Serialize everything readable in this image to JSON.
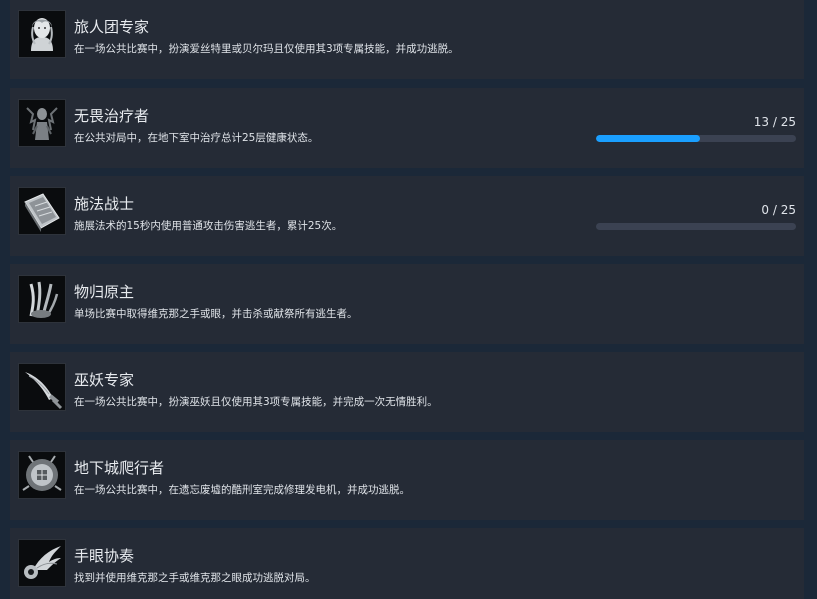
{
  "colors": {
    "background": "#1b2838",
    "card": "#252b36",
    "progress_fill": "#1a9fff",
    "progress_track": "#3b4252"
  },
  "achievements": [
    {
      "icon": "portrait-icon",
      "title": "旅人团专家",
      "description": "在一场公共比赛中，扮演爱丝特里或贝尔玛且仅使用其3项专属技能，并成功逃脱。"
    },
    {
      "icon": "healer-figure-icon",
      "title": "无畏治疗者",
      "description": "在公共对局中，在地下室中治疗总计25层健康状态。",
      "progress_text": "13 / 25",
      "progress": 0.52
    },
    {
      "icon": "spellbook-icon",
      "title": "施法战士",
      "description": "施展法术的15秒内使用普通攻击伤害逃生者，累计25次。",
      "progress_text": "0 / 25",
      "progress": 0
    },
    {
      "icon": "claw-hand-icon",
      "title": "物归原主",
      "description": "单场比赛中取得维克那之手或眼，并击杀或献祭所有逃生者。"
    },
    {
      "icon": "curved-blade-icon",
      "title": "巫妖专家",
      "description": "在一场公共比赛中，扮演巫妖且仅使用其3项专属技能，并完成一次无情胜利。"
    },
    {
      "icon": "dungeon-crest-icon",
      "title": "地下城爬行者",
      "description": "在一场公共比赛中，在遗忘废墟的酷刑室完成修理发电机，并成功逃脱。"
    },
    {
      "icon": "winged-eye-icon",
      "title": "手眼协奏",
      "description": "找到并使用维克那之手或维克那之眼成功逃脱对局。"
    }
  ]
}
